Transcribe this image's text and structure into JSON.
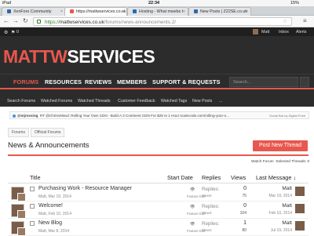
{
  "status": {
    "device": "iPad",
    "time": "22:34",
    "battery": "15%"
  },
  "tabs": [
    {
      "label": "XenForo Community",
      "color": "#2c6aa8"
    },
    {
      "label": "https://mattwservices.co.uk",
      "color": "#e8574e"
    },
    {
      "label": "Hosting - What mwebs t",
      "color": "#1e6fb5"
    },
    {
      "label": "New Posts | Z22SE.co.uk",
      "color": "#2c6aa8"
    }
  ],
  "address": {
    "scheme": "https://",
    "host": "mattwservices.co.uk",
    "path": "/forums/news-announcements.2/"
  },
  "topbar": {
    "notifications": "0",
    "user": "Matt",
    "inbox": "Inbox",
    "alerts": "Alerts"
  },
  "logo": {
    "part1": "MATTW",
    "part2": "SERVICES"
  },
  "mainnav": {
    "items": [
      "FORUMS",
      "RESOURCES",
      "REVIEWS",
      "MEMBERS",
      "SUPPORT & REQUESTS"
    ],
    "search_placeholder": "Search..."
  },
  "subnav": [
    "Search Forums",
    "Watched Forums",
    "Watched Threads",
    "Customer Feedback",
    "Watched Tags",
    "New Posts",
    "..."
  ],
  "ticker": {
    "handle": "@mjrossing",
    "text": "RT @ChrisVeland: Rolling Your Own CDN - Build A 3 Continent CDN For $25 In 1 Hour scalecode.com/rolling-your-o...",
    "right": "Social Bar by Digital Point"
  },
  "breadcrumb": [
    "Forums",
    "Official Forums"
  ],
  "page_title": "News & Announcements",
  "post_button": "Post New Thread",
  "watch": {
    "forum": "Watch Forum",
    "selected": "Selected Threads: 0"
  },
  "columns": {
    "title": "Title",
    "start": "Start Date",
    "replies": "Replies",
    "views": "Views",
    "last": "Last Message ↓"
  },
  "threads": [
    {
      "title": "Purchasing Work - Resource Manager",
      "meta": "Matt, Mar 19, 2014",
      "feature": "Feature Edit",
      "replies_label": "Replies:",
      "views_label": "Views:",
      "replies": "0",
      "views": "75",
      "last_user": "Matt",
      "last_date": "Mar 19, 2014"
    },
    {
      "title": "Welcome!",
      "meta": "Matt, Feb 10, 2014",
      "feature": "Feature Edit",
      "replies_label": "Replies:",
      "views_label": "Views:",
      "replies": "0",
      "views": "104",
      "last_user": "Matt",
      "last_date": "Feb 10, 2014"
    },
    {
      "title": "New Blog",
      "meta": "Matt, Mar 8, 2014",
      "feature": "Feature Edit",
      "replies_label": "Replies:",
      "views_label": "Views:",
      "replies": "1",
      "views": "80",
      "last_user": "Matt",
      "last_date": "Jul 19, 2014"
    }
  ]
}
